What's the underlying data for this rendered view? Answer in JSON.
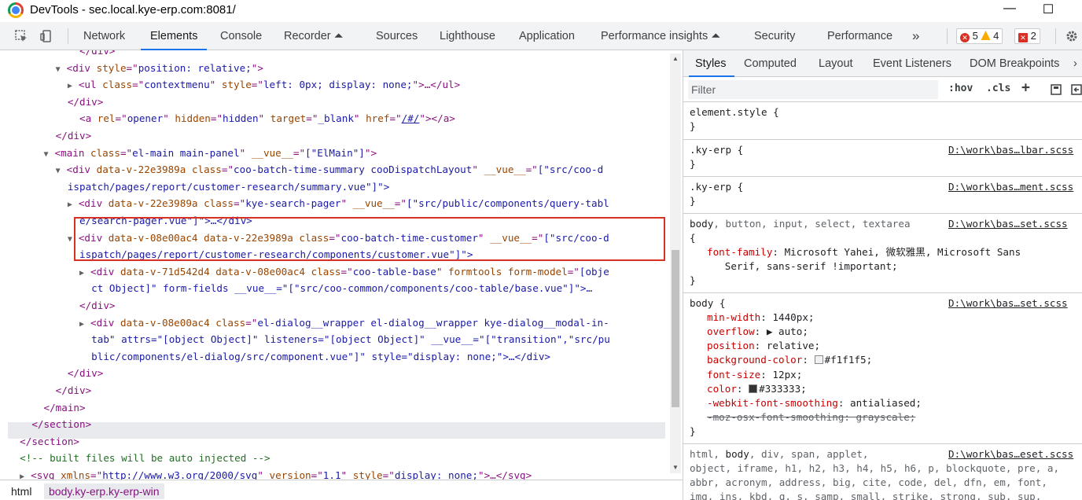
{
  "window": {
    "title": "DevTools - sec.local.kye-erp.com:8081/",
    "minimize": "—",
    "maximize": "☐"
  },
  "toolbar": {
    "tabs": [
      "Network",
      "Elements",
      "Console",
      "Recorder ⏶",
      "Sources",
      "Lighthouse",
      "Application",
      "Performance insights ⏶",
      "Security",
      "Performance",
      "»"
    ],
    "errors": "5",
    "warnings": "4",
    "issues": "2"
  },
  "elements": {
    "lines": [
      {
        "indent": "            ",
        "html": "</div>",
        "kind": "close"
      },
      {
        "indent": "        ",
        "tri": "▼",
        "tag": "div",
        "attrs": [
          [
            "style",
            "position: relative;"
          ]
        ],
        "end": ">"
      },
      {
        "indent": "          ",
        "tri": "▶",
        "tag": "ul",
        "attrs": [
          [
            "class",
            "contextmenu"
          ],
          [
            "style",
            "left: 0px; display: none;"
          ]
        ],
        "end": ">…</ul>"
      },
      {
        "indent": "          ",
        "html": "</div>",
        "kind": "close"
      },
      {
        "indent": "          ",
        "tag": "a",
        "attrs": [
          [
            "rel",
            "opener"
          ],
          [
            "hidden",
            "hidden"
          ],
          [
            "target",
            "_blank"
          ],
          [
            "href",
            "/#/"
          ]
        ],
        "end": "></a>"
      },
      {
        "indent": "        ",
        "html": "</div>",
        "kind": "close"
      },
      {
        "indent": "      ",
        "tri": "▼",
        "tag": "main",
        "attrs": [
          [
            "class",
            "el-main main-panel"
          ],
          [
            "__vue__",
            "[\"ElMain\"]"
          ]
        ],
        "end": ">"
      },
      {
        "indent": "        ",
        "tri": "▼",
        "tag": "div",
        "attrs": [
          [
            "data-v-22e3989a",
            null
          ],
          [
            "class",
            "coo-batch-time-summary cooDispatchLayout"
          ],
          [
            "__vue__",
            "[\"src/coo-d"
          ]
        ],
        "end": ""
      },
      {
        "indent": "        ",
        "raw": "ispatch/pages/report/customer-research/summary.vue\"]\">",
        "rawclass": "val"
      },
      {
        "indent": "          ",
        "tri": "▶",
        "tag": "div",
        "attrs": [
          [
            "data-v-22e3989a",
            null
          ],
          [
            "class",
            "kye-search-pager"
          ],
          [
            "__vue__",
            "[\"src/public/components/query-tabl"
          ]
        ],
        "end": ""
      },
      {
        "indent": "          ",
        "raw": "e/search-pager.vue\"]\">…</div>",
        "rawclass": "val"
      },
      {
        "indent": "          ",
        "tri": "▼",
        "tag": "div",
        "attrs": [
          [
            "data-v-08e00ac4",
            null
          ],
          [
            "data-v-22e3989a",
            null
          ],
          [
            "class",
            "coo-batch-time-customer"
          ],
          [
            "__vue__",
            "[\"src/coo-d"
          ]
        ],
        "end": ""
      },
      {
        "indent": "          ",
        "raw": "ispatch/pages/report/customer-research/components/customer.vue\"]\">",
        "rawclass": "val"
      },
      {
        "indent": "            ",
        "tri": "▶",
        "tag": "div",
        "attrs": [
          [
            "data-v-71d542d4",
            null
          ],
          [
            "data-v-08e00ac4",
            null
          ],
          [
            "class",
            "coo-table-base"
          ],
          [
            "formtools",
            null
          ],
          [
            "form-model",
            "[obje"
          ]
        ],
        "end": ""
      },
      {
        "indent": "            ",
        "raw": "ct Object]\" form-fields __vue__=\"[\"src/coo-common/components/coo-table/base.vue\"]\">…",
        "rawclass": "val"
      },
      {
        "indent": "            ",
        "html": "</div>",
        "kind": "close"
      },
      {
        "indent": "            ",
        "tri": "▶",
        "tag": "div",
        "attrs": [
          [
            "data-v-08e00ac4",
            null
          ],
          [
            "class",
            "el-dialog__wrapper el-dialog__wrapper kye-dialog__modal-in-"
          ]
        ],
        "end": ""
      },
      {
        "indent": "            ",
        "raw": "tab\" attrs=\"[object Object]\" listeners=\"[object Object]\" __vue__=\"[\"transition\",\"src/pu",
        "rawclass": "val"
      },
      {
        "indent": "            ",
        "raw": "blic/components/el-dialog/src/component.vue\"]\" style=\"display: none;\">…</div>",
        "rawclass": "val"
      },
      {
        "indent": "          ",
        "html": "</div>",
        "kind": "close"
      },
      {
        "indent": "        ",
        "html": "</div>",
        "kind": "close"
      },
      {
        "indent": "      ",
        "html": "</main>",
        "kind": "close"
      },
      {
        "indent": "    ",
        "html": "</section>",
        "kind": "close"
      },
      {
        "indent": "  ",
        "html": "</section>",
        "kind": "close"
      },
      {
        "indent": "  ",
        "html": "<!-- built files will be auto injected -->",
        "kind": "comment"
      },
      {
        "indent": "  ",
        "tri": "▶",
        "tag": "svg",
        "attrs": [
          [
            "xmlns",
            "http://www.w3.org/2000/svg"
          ],
          [
            "version",
            "1.1"
          ],
          [
            "style",
            "display: none;"
          ]
        ],
        "end": ">…</svg>"
      }
    ]
  },
  "breadcrumbs": [
    "html",
    "body.ky-erp.ky-erp-win"
  ],
  "styles": {
    "tabs": [
      "Styles",
      "Computed",
      "Layout",
      "Event Listeners",
      "DOM Breakpoints",
      "›"
    ],
    "filter_placeholder": "Filter",
    "hov": ":hov",
    "cls": ".cls",
    "plus": "+",
    "rules": [
      {
        "selector": "element.style {",
        "source": "",
        "lines": [
          "}"
        ]
      },
      {
        "selector": ".ky-erp {",
        "source": "D:\\work\\bas…lbar.scss",
        "lines": [
          "}"
        ]
      },
      {
        "selector": ".ky-erp {",
        "source": "D:\\work\\bas…ment.scss",
        "lines": [
          "}"
        ]
      },
      {
        "selector": "body, button, input, select, textarea",
        "source": "D:\\work\\bas…set.scss",
        "lines": [
          "{",
          "font-family|Microsoft Yahei, 微软雅黑, Microsoft Sans",
          "   Serif, sans-serif !important;",
          "}"
        ]
      },
      {
        "selector": "body {",
        "source": "D:\\work\\bas…set.scss",
        "lines": [
          "min-width|1440px;",
          "overflow|▶ auto;",
          "position|relative;",
          "background-color|#f1f1f5;",
          "font-size|12px;",
          "color|#333333;",
          "-webkit-font-smoothing|antialiased;",
          "-moz-osx-font-smoothing: grayscale;",
          "}"
        ]
      },
      {
        "selector": "html, body, div, span, applet,",
        "source": "D:\\work\\bas…eset.scss",
        "lines": [
          "object, iframe, h1, h2, h3, h4, h5, h6, p, blockquote, pre, a,",
          "abbr, acronym, address, big, cite, code, del, dfn, em, font,",
          "img, ins, kbd, q, s, samp, small, strike, strong, sub, sup,"
        ]
      }
    ],
    "bg_swatch": "#f1f1f5",
    "color_swatch": "#333333"
  }
}
